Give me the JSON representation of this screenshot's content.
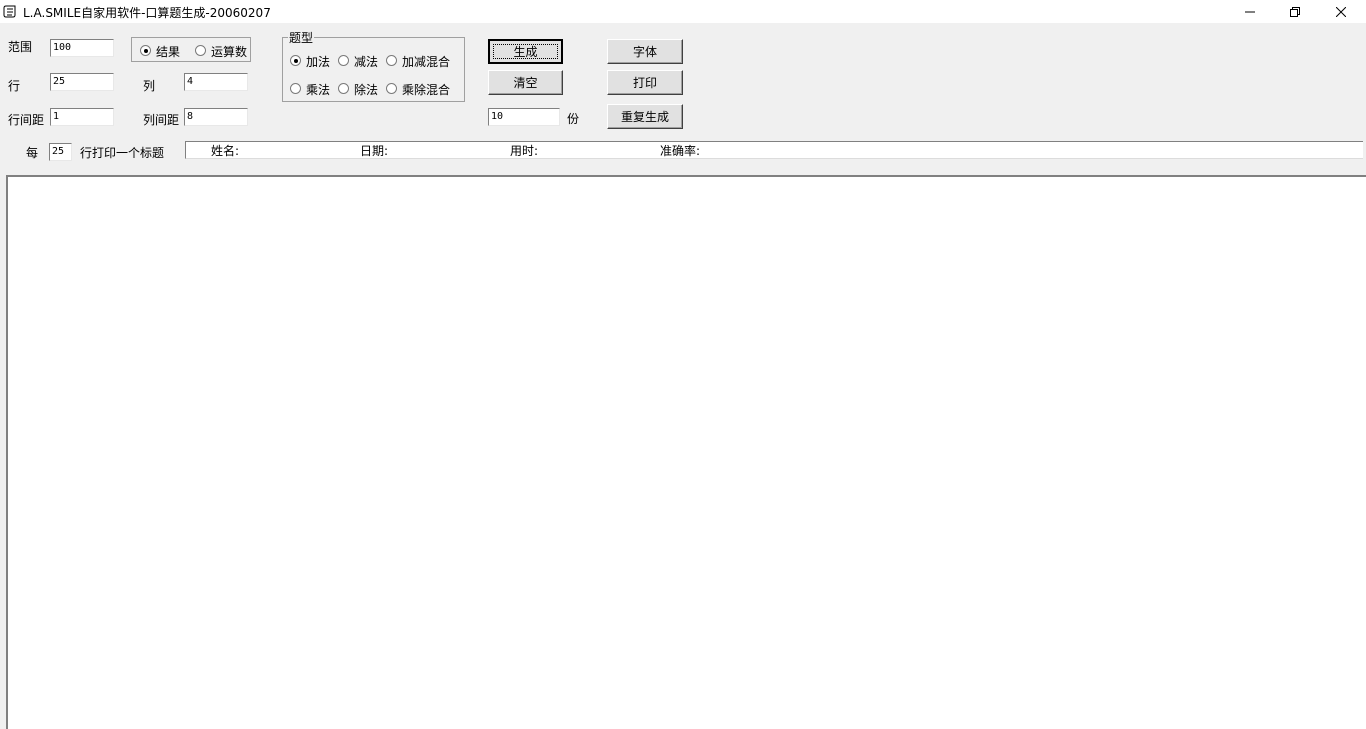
{
  "window": {
    "title": "L.A.SMILE自家用软件-口算题生成-20060207",
    "minimize_icon": "minimize-icon",
    "maximize_icon": "restore-icon",
    "close_icon": "close-icon"
  },
  "settings": {
    "range_label": "范围",
    "range_value": "100",
    "rows_label": "行",
    "rows_value": "25",
    "cols_label": "列",
    "cols_value": "4",
    "row_gap_label": "行间距",
    "row_gap_value": "1",
    "col_gap_label": "列间距",
    "col_gap_value": "8"
  },
  "answer_mode": {
    "options": [
      {
        "label": "结果",
        "selected": true
      },
      {
        "label": "运算数",
        "selected": false
      }
    ]
  },
  "question_type": {
    "group_label": "题型",
    "options": [
      {
        "label": "加法",
        "selected": true
      },
      {
        "label": "减法",
        "selected": false
      },
      {
        "label": "加减混合",
        "selected": false
      },
      {
        "label": "乘法",
        "selected": false
      },
      {
        "label": "除法",
        "selected": false
      },
      {
        "label": "乘除混合",
        "selected": false
      }
    ]
  },
  "actions": {
    "generate": "生成",
    "clear": "清空",
    "copies_value": "10",
    "copies_unit": "份",
    "font": "字体",
    "print": "打印",
    "regenerate": "重复生成"
  },
  "header_line": {
    "every_label": "每",
    "every_value": "25",
    "suffix_label": "行打印一个标题",
    "name_label": "姓名:",
    "date_label": "日期:",
    "time_label": "用时:",
    "accuracy_label": "准确率:"
  }
}
